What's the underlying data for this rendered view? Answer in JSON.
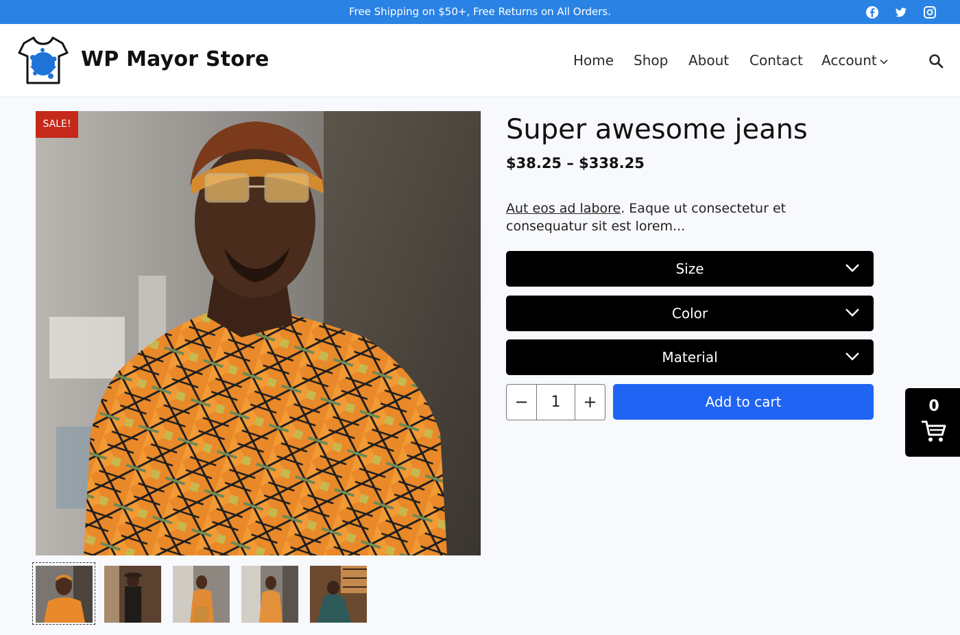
{
  "topbar": {
    "message": "Free Shipping on $50+, Free Returns on All Orders.",
    "social_icons": [
      "facebook-icon",
      "twitter-icon",
      "instagram-icon"
    ]
  },
  "header": {
    "site_title": "WP Mayor Store",
    "logo_icon": "tshirt-splash-logo",
    "nav": {
      "home": "Home",
      "shop": "Shop",
      "about": "About",
      "contact": "Contact",
      "account": "Account"
    },
    "search_icon": "search-icon"
  },
  "product": {
    "badge": "SALE!",
    "title": "Super awesome jeans",
    "price": "$38.25 – $338.25",
    "desc_link": "Aut eos ad labore",
    "desc_rest": ". Eaque ut consectetur et consequatur sit est lorem...",
    "options": {
      "size": "Size",
      "color": "Color",
      "material": "Material"
    },
    "quantity": {
      "minus": "−",
      "value": "1",
      "plus": "+"
    },
    "add_to_cart": "Add to cart",
    "thumbnail_count": 5
  },
  "cart": {
    "count": "0",
    "icon": "cart-icon"
  },
  "colors": {
    "topbar": "#2a82e4",
    "add_to_cart": "#1f64f2",
    "sale_badge": "#c4291a",
    "select_bg": "#000000"
  }
}
